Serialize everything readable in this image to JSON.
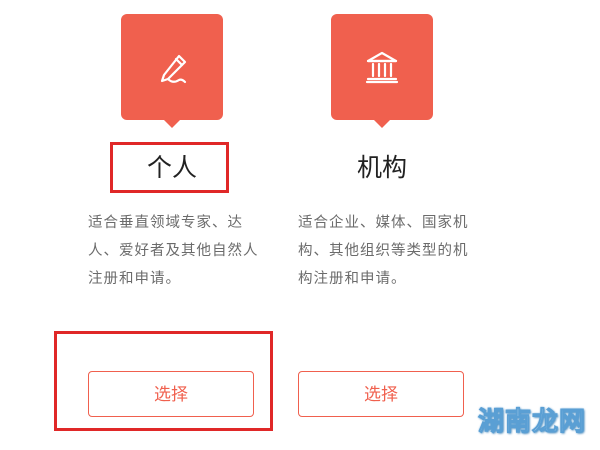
{
  "colors": {
    "accent": "#f0604e",
    "highlight": "#e02828",
    "title_text": "#222222",
    "desc_text": "#6b6b6b"
  },
  "cards": [
    {
      "icon": "pencil-icon",
      "title": "个人",
      "description": "适合垂直领域专家、达人、爱好者及其他自然人注册和申请。",
      "button_label": "选择"
    },
    {
      "icon": "institution-building-icon",
      "title": "机构",
      "description": "适合企业、媒体、国家机构、其他组织等类型的机构注册和申请。",
      "button_label": "选择"
    }
  ],
  "watermark": {
    "text": "湖南龙网"
  }
}
